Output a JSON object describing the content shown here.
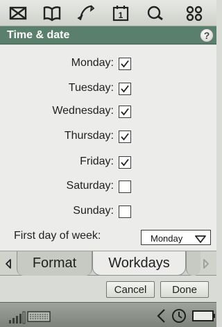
{
  "app": {
    "title": "Time & date",
    "help_glyph": "?"
  },
  "toolbar": {
    "icons": [
      "messaging-icon",
      "contacts-book-icon",
      "phone-icon",
      "calendar-icon",
      "search-icon",
      "apps-grid-icon"
    ],
    "calendar_day": "1"
  },
  "workdays": {
    "days": [
      {
        "label": "Monday:",
        "checked": true
      },
      {
        "label": "Tuesday:",
        "checked": true
      },
      {
        "label": "Wednesday:",
        "checked": true
      },
      {
        "label": "Thursday:",
        "checked": true
      },
      {
        "label": "Friday:",
        "checked": true
      },
      {
        "label": "Saturday:",
        "checked": false
      },
      {
        "label": "Sunday:",
        "checked": false
      }
    ],
    "first_day_label": "First day of week:",
    "first_day_value": "Monday"
  },
  "tabs": {
    "items": [
      {
        "label": "Format",
        "active": false
      },
      {
        "label": "Workdays",
        "active": true
      }
    ]
  },
  "buttons": {
    "cancel": "Cancel",
    "done": "Done"
  },
  "statusbar": {
    "icons": [
      "signal-strength-icon",
      "keyboard-icon",
      "volume-icon",
      "clock-icon",
      "battery-icon"
    ]
  },
  "colors": {
    "titlebar": "#5a806d",
    "content_bg": "#ecedea",
    "chrome_bg": "#d9dbd6"
  }
}
